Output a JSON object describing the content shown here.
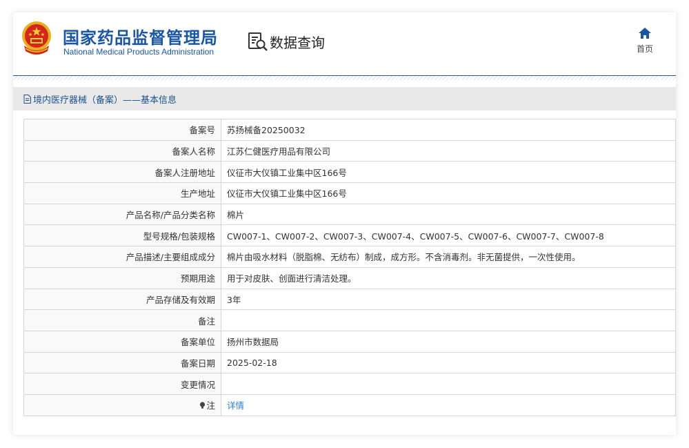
{
  "header": {
    "title_cn": "国家药品监督管理局",
    "title_en": "National Medical Products Administration",
    "query_label": "数据查询",
    "home_label": "首页"
  },
  "section": {
    "title": "境内医疗器械（备案）——基本信息"
  },
  "table": {
    "rows": [
      {
        "label": "备案号",
        "value": "苏扬械备20250032"
      },
      {
        "label": "备案人名称",
        "value": "江苏仁健医疗用品有限公司"
      },
      {
        "label": "备案人注册地址",
        "value": "仪征市大仪镇工业集中区166号"
      },
      {
        "label": "生产地址",
        "value": "仪征市大仪镇工业集中区166号"
      },
      {
        "label": "产品名称/产品分类名称",
        "value": "棉片"
      },
      {
        "label": "型号规格/包装规格",
        "value": "CW007-1、CW007-2、CW007-3、CW007-4、CW007-5、CW007-6、CW007-7、CW007-8"
      },
      {
        "label": "产品描述/主要组成成分",
        "value": "棉片由吸水材料（脱脂棉、无纺布）制成，成方形。不含消毒剂。非无菌提供，一次性使用。"
      },
      {
        "label": "预期用途",
        "value": "用于对皮肤、创面进行清洁处理。"
      },
      {
        "label": "产品存储及有效期",
        "value": "3年"
      },
      {
        "label": "备注",
        "value": ""
      },
      {
        "label": "备案单位",
        "value": "扬州市数据局"
      },
      {
        "label": "备案日期",
        "value": "2025-02-18"
      },
      {
        "label": "变更情况",
        "value": ""
      }
    ],
    "note_label": "注",
    "note_link": "详情"
  },
  "colors": {
    "brand_blue": "#1a56a6",
    "link_blue": "#2a7fd0",
    "section_bg": "#e9e9e9"
  },
  "icons": {
    "emblem": "national-emblem-icon",
    "query": "document-search-icon",
    "home": "home-icon",
    "section": "document-icon",
    "note": "lightbulb-icon"
  }
}
